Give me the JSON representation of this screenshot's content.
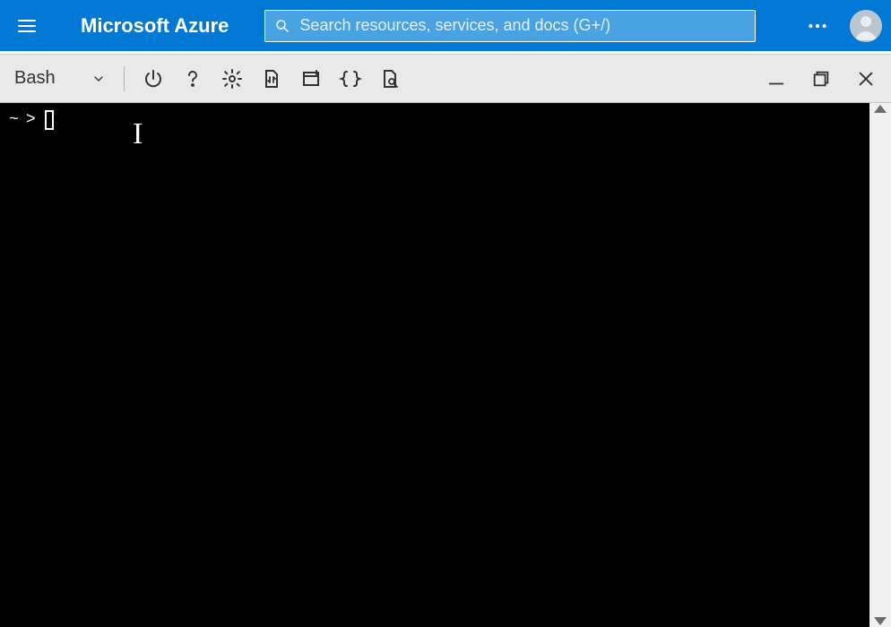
{
  "header": {
    "brand": "Microsoft Azure",
    "search_placeholder": "Search resources, services, and docs (G+/)",
    "search_value": ""
  },
  "cloud_shell": {
    "shell_selector": {
      "label": "Bash"
    },
    "tooltips": {
      "restart": "Restart Cloud Shell",
      "help": "Help",
      "settings": "Settings",
      "upload_download": "Upload/Download files",
      "new_session": "Open new session",
      "editor": "Open editor",
      "web_preview": "Web preview",
      "minimize": "Minimize",
      "maximize": "Maximize",
      "close": "Close"
    },
    "terminal": {
      "prompt_path": "~",
      "prompt_symbol": ">",
      "input": ""
    }
  }
}
